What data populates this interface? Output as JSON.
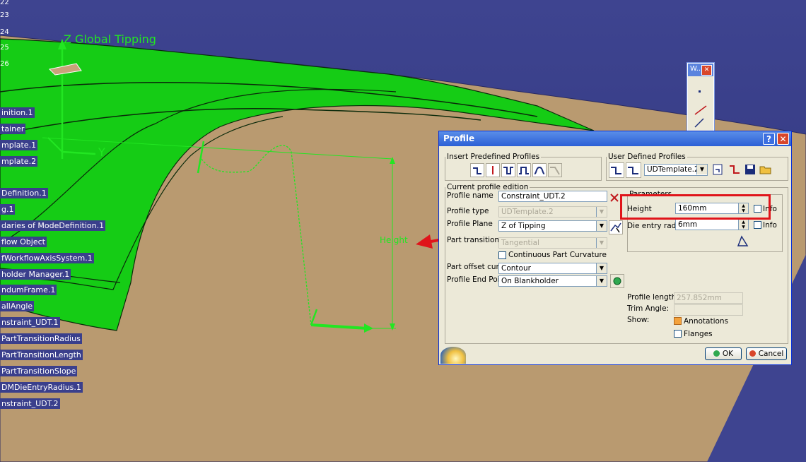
{
  "viewport": {
    "tree_numbers": [
      "22",
      "23",
      "24",
      "25",
      "26"
    ],
    "tree_items": [
      "inition.1",
      "tainer",
      "mplate.1",
      "mplate.2",
      "Definition.1",
      "g.1",
      "daries of ModeDefinition.1",
      "flow Object",
      "fWorkflowAxisSystem.1",
      "holder Manager.1",
      "ndumFrame.1",
      "allAngle",
      "nstraint_UDT.1",
      "PartTransitionRadius",
      "PartTransitionLength",
      "PartTransitionSlope",
      "DMDieEntryRadius.1",
      "nstraint_UDT.2"
    ],
    "axis_label": "Z Global Tipping",
    "height_label": "Height",
    "axis_x_label": "Y"
  },
  "mini_toolbar": {
    "title": "W..."
  },
  "dialog": {
    "title": "Profile",
    "insert_group_label": "Insert Predefined Profiles",
    "user_group_label": "User Defined Profiles",
    "udt_template": "UDTemplate.2",
    "edition_group_label": "Current profile edition",
    "profile_name_label": "Profile name",
    "profile_name": "Constraint_UDT.2",
    "profile_type_label": "Profile type",
    "profile_type": "UDTemplate.2",
    "profile_plane_label": "Profile Plane",
    "profile_plane": "Z of Tipping",
    "part_transition_label": "Part transition",
    "part_transition": "Tangential",
    "continuous_label": "Continuous Part Curvature",
    "part_offset_label": "Part offset curve",
    "part_offset": "Contour",
    "end_point_label": "Profile End Point",
    "end_point": "On Blankholder",
    "parameters_label": "Parameters",
    "height_label": "Height",
    "height_value": "160mm",
    "info_label": "Info",
    "die_entry_label": "Die entry radius",
    "die_entry_value": "6mm",
    "profile_length_label": "Profile length:",
    "profile_length": "257.852mm",
    "trim_angle_label": "Trim Angle:",
    "trim_angle": "",
    "show_label": "Show:",
    "annotations_label": "Annotations",
    "flanges_label": "Flanges",
    "ok_label": "OK",
    "cancel_label": "Cancel"
  }
}
